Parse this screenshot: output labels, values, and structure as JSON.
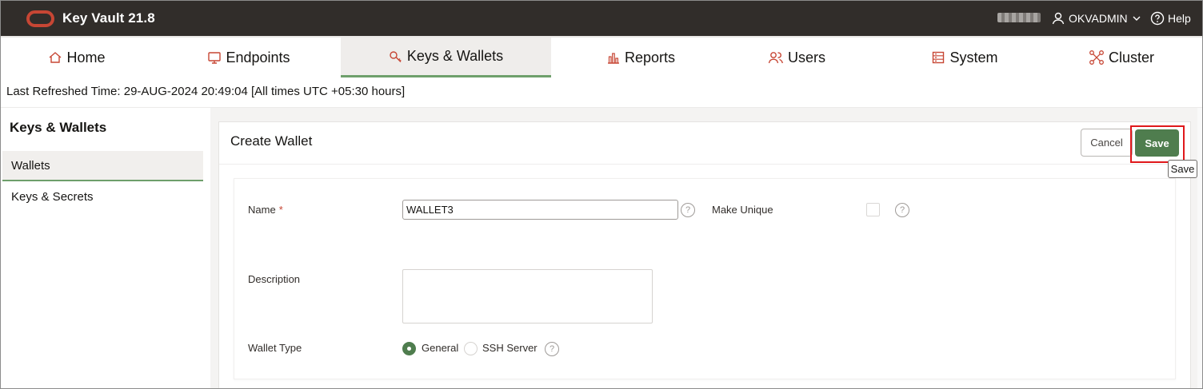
{
  "app": {
    "title": "Key Vault 21.8",
    "user": "OKVADMIN",
    "help": "Help"
  },
  "nav": {
    "tabs": [
      {
        "label": "Home",
        "icon": "home-icon"
      },
      {
        "label": "Endpoints",
        "icon": "monitor-icon"
      },
      {
        "label": "Keys & Wallets",
        "icon": "key-icon",
        "active": true
      },
      {
        "label": "Reports",
        "icon": "bar-chart-icon"
      },
      {
        "label": "Users",
        "icon": "users-icon"
      },
      {
        "label": "System",
        "icon": "server-icon"
      },
      {
        "label": "Cluster",
        "icon": "cluster-icon"
      }
    ]
  },
  "refresh_text": "Last Refreshed Time: 29-AUG-2024 20:49:04 [All times UTC +05:30 hours]",
  "sidebar": {
    "title": "Keys & Wallets",
    "items": [
      {
        "label": "Wallets",
        "active": true
      },
      {
        "label": "Keys & Secrets",
        "active": false
      }
    ]
  },
  "panel": {
    "title": "Create Wallet",
    "cancel_label": "Cancel",
    "save_label": "Save",
    "tooltip": "Save"
  },
  "form": {
    "name_label": "Name",
    "required_mark": "*",
    "name_value": "WALLET3",
    "help_glyph": "?",
    "make_unique_label": "Make Unique",
    "make_unique_checked": false,
    "description_label": "Description",
    "description_value": "",
    "wallet_type_label": "Wallet Type",
    "wallet_type_options": [
      "General",
      "SSH Server"
    ],
    "wallet_type_selected": "General"
  },
  "colors": {
    "topbar": "#312d2a",
    "brand_red": "#c74634",
    "accent_green": "#4f7d4e",
    "highlight_red": "#e0181b"
  }
}
